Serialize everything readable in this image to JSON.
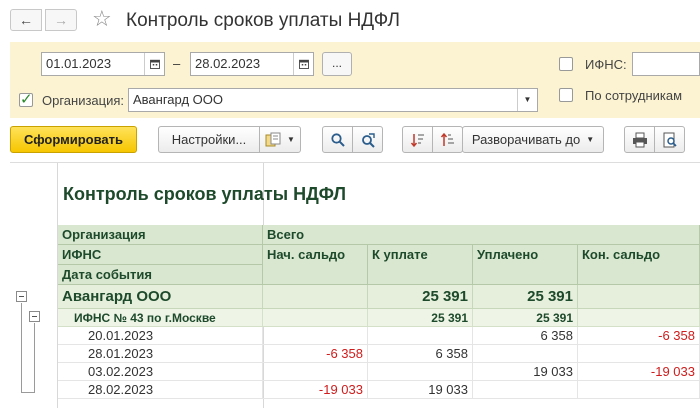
{
  "window": {
    "title": "Контроль сроков уплаты НДФЛ"
  },
  "params": {
    "date_from": "01.01.2023",
    "date_separator": "–",
    "date_to": "28.02.2023",
    "ellipsis_label": "...",
    "ifns_label": "ИФНС:",
    "ifns_value": "",
    "ifns_checked": false,
    "org_checked": true,
    "org_label": "Организация:",
    "org_value": "Авангард ООО",
    "by_employee_label": "По сотрудникам",
    "by_employee_checked": false
  },
  "toolbar": {
    "generate_label": "Сформировать",
    "settings_label": "Настройки...",
    "expand_label": "Разворачивать до"
  },
  "report": {
    "title": "Контроль сроков уплаты НДФЛ",
    "headers": {
      "org": "Организация",
      "ifns": "ИФНС",
      "event_date": "Дата события",
      "total": "Всего",
      "start_balance": "Нач. сальдо",
      "to_pay": "К уплате",
      "paid": "Уплачено",
      "end_balance": "Кон. сальдо"
    },
    "group1": {
      "name": "Авангард ООО",
      "to_pay": "25 391",
      "paid": "25 391"
    },
    "group2": {
      "name": "ИФНС № 43 по г.Москве",
      "to_pay": "25 391",
      "paid": "25 391"
    },
    "rows": [
      {
        "date": "20.01.2023",
        "start": "",
        "to_pay": "",
        "paid": "6 358",
        "end": "-6 358"
      },
      {
        "date": "28.01.2023",
        "start": "-6 358",
        "to_pay": "6 358",
        "paid": "",
        "end": ""
      },
      {
        "date": "03.02.2023",
        "start": "",
        "to_pay": "",
        "paid": "19 033",
        "end": "-19 033"
      },
      {
        "date": "28.02.2023",
        "start": "-19 033",
        "to_pay": "19 033",
        "paid": "",
        "end": ""
      }
    ]
  },
  "colors": {
    "params_bg": "#fbf3d2",
    "primary_button": "#f6c600",
    "header_bg": "#d9e7d0",
    "report_title": "#1d4a2b",
    "negative": "#d01c1c"
  }
}
